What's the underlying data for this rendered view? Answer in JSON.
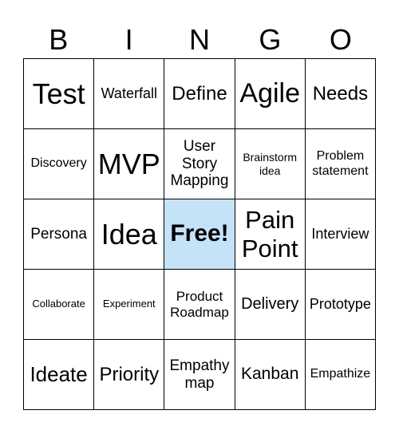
{
  "header": [
    "B",
    "I",
    "N",
    "G",
    "O"
  ],
  "free_color": "#c5e3f7",
  "cells": [
    [
      {
        "text": "Test",
        "size": 36
      },
      {
        "text": "Waterfall",
        "size": 18
      },
      {
        "text": "Define",
        "size": 24
      },
      {
        "text": "Agile",
        "size": 34
      },
      {
        "text": "Needs",
        "size": 24
      }
    ],
    [
      {
        "text": "Discovery",
        "size": 16
      },
      {
        "text": "MVP",
        "size": 36
      },
      {
        "text": "User Story Mapping",
        "size": 19
      },
      {
        "text": "Brainstorm idea",
        "size": 14
      },
      {
        "text": "Problem statement",
        "size": 16
      }
    ],
    [
      {
        "text": "Persona",
        "size": 19
      },
      {
        "text": "Idea",
        "size": 36
      },
      {
        "text": "Free!",
        "size": 30,
        "free": true
      },
      {
        "text": "Pain Point",
        "size": 31
      },
      {
        "text": "Interview",
        "size": 18
      }
    ],
    [
      {
        "text": "Collaborate",
        "size": 13
      },
      {
        "text": "Experiment",
        "size": 13
      },
      {
        "text": "Product Roadmap",
        "size": 17
      },
      {
        "text": "Delivery",
        "size": 20
      },
      {
        "text": "Prototype",
        "size": 18
      }
    ],
    [
      {
        "text": "Ideate",
        "size": 26
      },
      {
        "text": "Priority",
        "size": 24
      },
      {
        "text": "Empathy map",
        "size": 19
      },
      {
        "text": "Kanban",
        "size": 21
      },
      {
        "text": "Empathize",
        "size": 16
      }
    ]
  ]
}
